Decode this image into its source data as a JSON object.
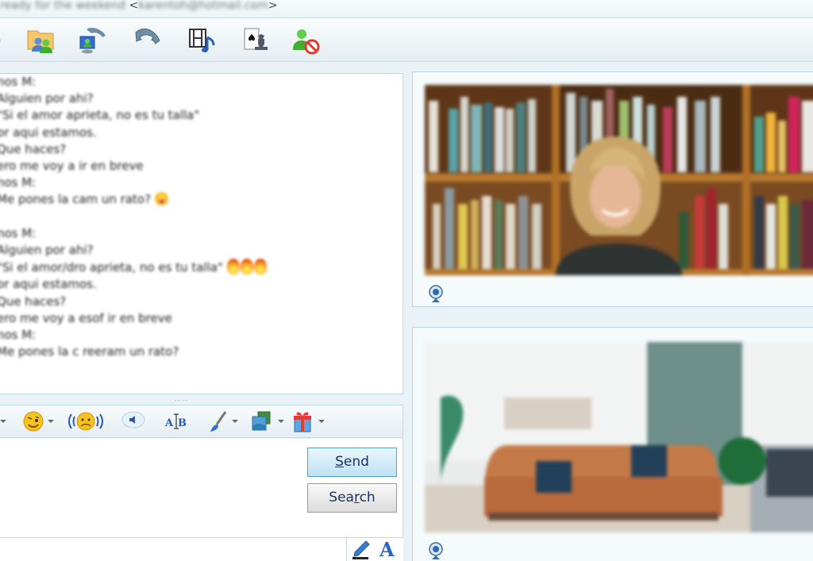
{
  "window": {
    "status_message": "ready for the weekend",
    "email_open": "<",
    "email": "karentoh@hotmail.com",
    "email_close": ">"
  },
  "toolbar": {
    "items": [
      {
        "name": "share-folders",
        "icon": "folder-contacts-icon"
      },
      {
        "name": "video-call",
        "icon": "video-call-icon"
      },
      {
        "name": "voice-call",
        "icon": "phone-icon"
      },
      {
        "name": "activities",
        "icon": "film-music-icon"
      },
      {
        "name": "games",
        "icon": "cards-chess-icon"
      },
      {
        "name": "block",
        "icon": "block-contact-icon"
      }
    ]
  },
  "chat": {
    "lines": [
      {
        "text": "nos M:"
      },
      {
        "text": "Alguien por ahi?"
      },
      {
        "text": "\"Si el amor aprieta, no es tu talla\""
      },
      {
        "text": "or aqui estamos."
      },
      {
        "text": "Que haces?"
      },
      {
        "text": "ero me voy a ir en breve"
      },
      {
        "text": "nos M:"
      },
      {
        "text": "Me pones la cam un rato?",
        "emoji": "tongue-face"
      },
      {
        "text": ""
      },
      {
        "text": "nos M:"
      },
      {
        "text": "Alguien por ahi?"
      },
      {
        "text": "\"Si el amor/dro aprieta, no es tu talla\"",
        "emoji": "fire-x3"
      },
      {
        "text": "or aqui estamos."
      },
      {
        "text": "Que haces?"
      },
      {
        "text": "ero me voy a esof ir en breve"
      },
      {
        "text": "nos M:"
      },
      {
        "text": "Me pones la c   reeram un rato?"
      }
    ]
  },
  "format_toolbar": {
    "items": [
      {
        "name": "emoticons",
        "icon": "wink-smiley-icon",
        "has_dropdown": true
      },
      {
        "name": "nudge",
        "icon": "nudge-icon",
        "has_dropdown": false
      },
      {
        "name": "voice-clip",
        "icon": "voice-clip-icon",
        "has_dropdown": false
      },
      {
        "name": "font",
        "icon": "font-format-icon",
        "has_dropdown": false
      },
      {
        "name": "background",
        "icon": "paintbrush-icon",
        "has_dropdown": true
      },
      {
        "name": "images",
        "icon": "picture-icon",
        "has_dropdown": true
      },
      {
        "name": "gifts",
        "icon": "gift-icon",
        "has_dropdown": true
      }
    ]
  },
  "compose": {
    "message_value": "",
    "send_label_pre": "",
    "send_label_underline": "S",
    "send_label_post": "end",
    "search_label_pre": "Sea",
    "search_label_underline": "r",
    "search_label_post": "ch"
  },
  "bottom": {
    "handwriting_icon": "pen-icon",
    "font_icon_label": "A"
  },
  "video": {
    "contact_feed": {
      "scene": "woman smiling in front of bookshelves",
      "icon": "webcam-icon"
    },
    "own_feed": {
      "scene": "living room with orange sofa",
      "icon": "webcam-icon"
    }
  },
  "colors": {
    "accent": "#5a9fc4",
    "panel_bg": "#e9f2f6",
    "border": "#c2d8e2",
    "button_text": "#1e3060"
  }
}
